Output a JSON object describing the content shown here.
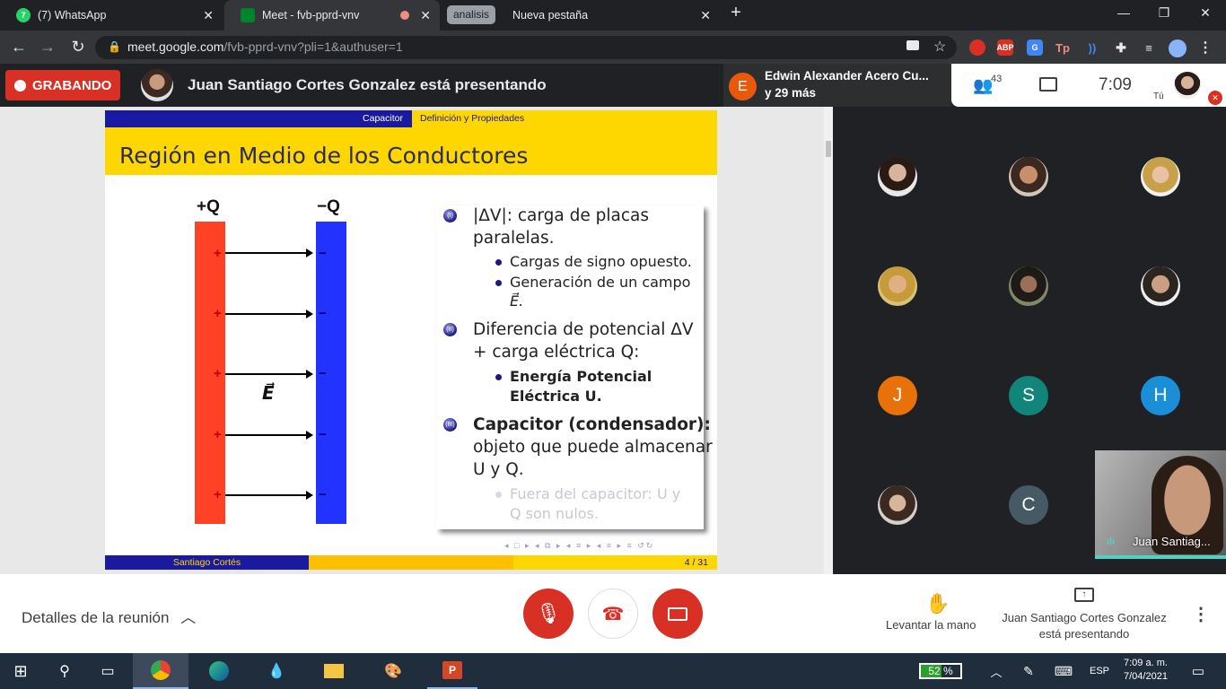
{
  "browser": {
    "tabs": [
      {
        "title": "(7) WhatsApp",
        "badge": "7"
      },
      {
        "title": "Meet - fvb-pprd-vnv"
      },
      {
        "title": "Nueva pestaña"
      }
    ],
    "group_label": "analisis",
    "url_host": "meet.google.com",
    "url_path": "/fvb-pprd-vnv?pli=1&authuser=1",
    "extensions": [
      "ABP",
      "Tp"
    ]
  },
  "meet": {
    "recording_label": "GRABANDO",
    "presenting_banner": "Juan Santiago Cortes Gonzalez está presentando",
    "notification": {
      "avatar_letter": "E",
      "line1": "Edwin Alexander Acero Cu...",
      "line2": "y 29 más"
    },
    "people_count": "43",
    "time": "7:09",
    "self_label": "Tú",
    "participants": [
      {
        "letter": "J",
        "color": "#e8710a"
      },
      {
        "letter": "S",
        "color": "#12857a"
      },
      {
        "letter": "H",
        "color": "#1a8fd8"
      },
      {
        "letter": "C",
        "color": "#455a64"
      }
    ],
    "selfview_name": "Juan Santiag...",
    "details_label": "Detalles de la reunión",
    "raise_hand_label": "Levantar la mano",
    "presenting_footer": "Juan Santiago Cortes Gonzalez está presentando"
  },
  "slide": {
    "nav_section": "Capacitor",
    "nav_subsection": "Definición y Propiedades",
    "title": "Región en Medio de los Conductores",
    "plate_positive": "+Q",
    "plate_negative": "−Q",
    "plus_sign": "+",
    "minus_sign": "−",
    "field_label": "E⃗",
    "bullet1_line1": "|ΔV|: carga de placas",
    "bullet1_line2": "paralelas.",
    "sub1a": "Cargas de signo opuesto.",
    "sub1b_line1": "Generación de un campo",
    "sub1b_line2": "E⃗.",
    "bullet2_line1": "Diferencia de potencial ΔV",
    "bullet2_line2": "+ carga eléctrica Q:",
    "sub2a_line1": "Energía Potencial",
    "sub2a_line2": "Eléctrica U.",
    "bullet3_line1": "Capacitor (condensador):",
    "bullet3_line2": "objeto que puede almacenar",
    "bullet3_line3": "U y Q.",
    "sub3a_line1": "Fuera del capacitor: U y",
    "sub3a_line2": "Q son nulos.",
    "footer_author": "Santiago Cortés",
    "footer_page": "4 / 31"
  },
  "taskbar": {
    "battery_percent": 52,
    "battery_text": "52 %",
    "language": "ESP",
    "time": "7:09 a. m.",
    "date": "7/04/2021"
  }
}
